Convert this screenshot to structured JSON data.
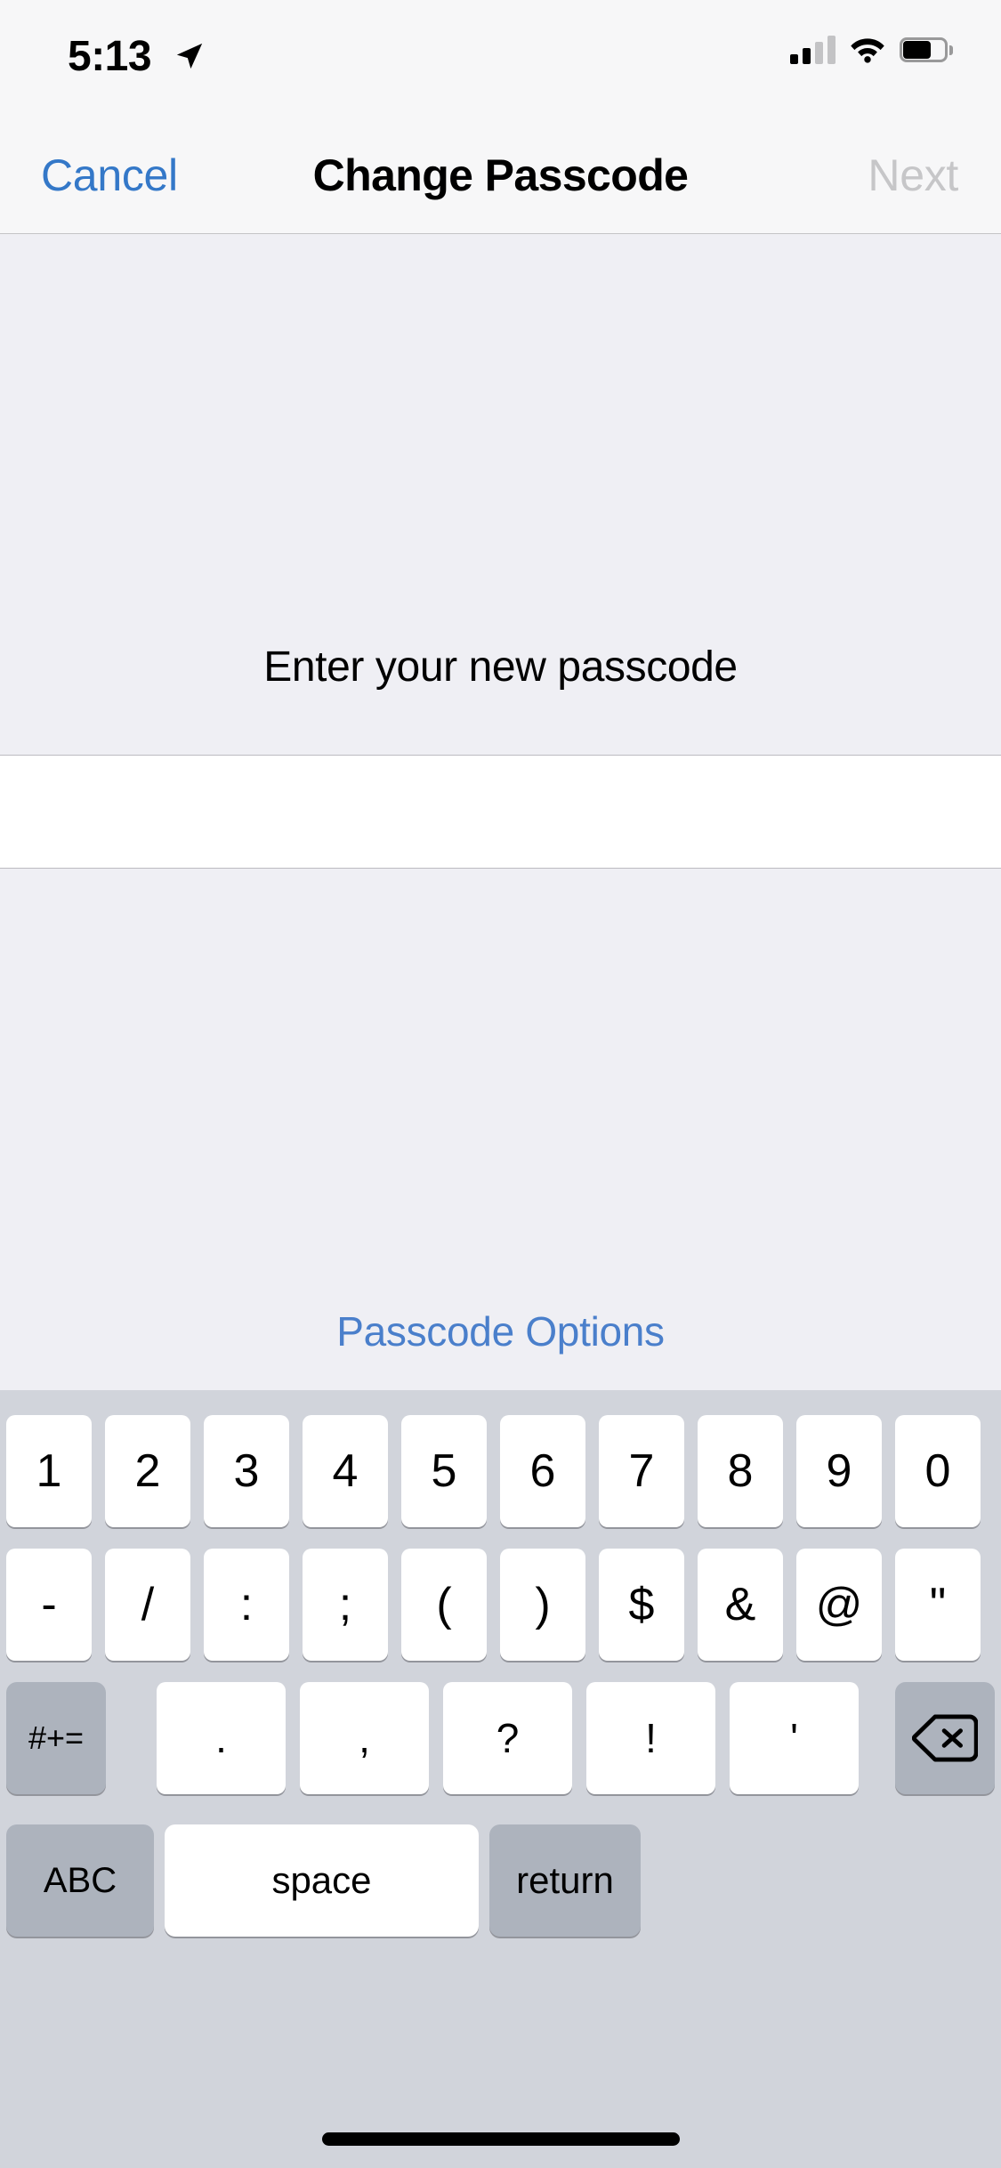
{
  "status_bar": {
    "time": "5:13",
    "location_icon": "location-arrow-icon",
    "signal_icon": "cellular-signal-icon",
    "signal_bars_filled": 2,
    "signal_bars_total": 4,
    "wifi_icon": "wifi-icon",
    "battery_icon": "battery-icon",
    "battery_level_percent": 58
  },
  "nav_bar": {
    "cancel_label": "Cancel",
    "title": "Change Passcode",
    "next_label": "Next",
    "cancel_color": "#3478C8",
    "next_color": "#C6C6C8",
    "title_color": "#000000"
  },
  "content": {
    "prompt": "Enter your new passcode",
    "passcode_value": "",
    "passcode_placeholder": "",
    "passcode_options_label": "Passcode Options",
    "passcode_options_color": "#4A7FCB",
    "background_color": "#EFEFF4",
    "field_background_color": "#FFFFFF"
  },
  "keyboard": {
    "layout": "numbers-symbols",
    "background_color": "#D1D4DB",
    "key_light_color": "#FFFFFF",
    "key_dark_color": "#ADB3BD",
    "row1": [
      "1",
      "2",
      "3",
      "4",
      "5",
      "6",
      "7",
      "8",
      "9",
      "0"
    ],
    "row2": [
      "-",
      "/",
      ":",
      ";",
      "(",
      ")",
      "$",
      "&",
      "@",
      "\""
    ],
    "row3": {
      "shift_label": "#+=",
      "keys": [
        ".",
        ",",
        "?",
        "!",
        "'"
      ],
      "backspace_icon": "backspace-icon"
    },
    "row4": {
      "abc_label": "ABC",
      "space_label": "space",
      "return_label": "return"
    }
  },
  "home_indicator": {
    "icon": "home-indicator"
  }
}
